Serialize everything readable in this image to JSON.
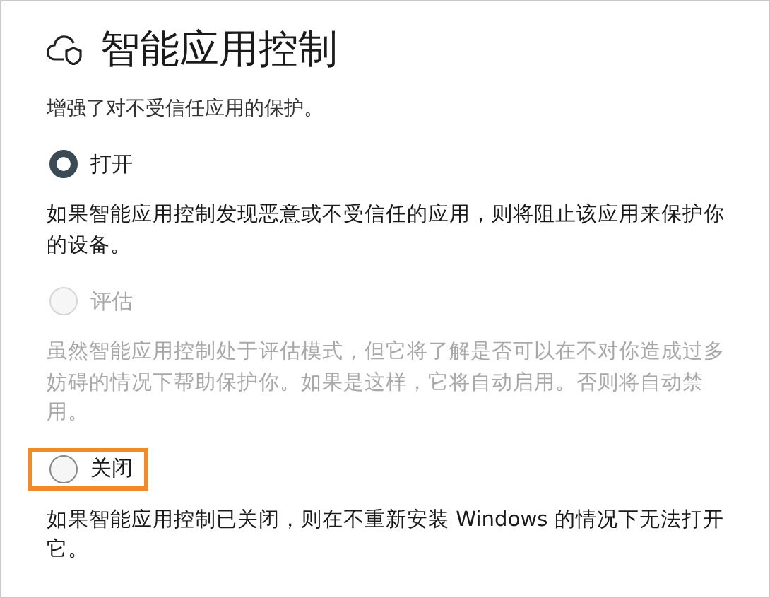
{
  "title": "智能应用控制",
  "subtitle": "增强了对不受信任应用的保护。",
  "options": [
    {
      "label": "打开",
      "selected": true,
      "disabled": false,
      "highlighted": false,
      "description": "如果智能应用控制发现恶意或不受信任的应用，则将阻止该应用来保护你的设备。"
    },
    {
      "label": "评估",
      "selected": false,
      "disabled": true,
      "highlighted": false,
      "description": "虽然智能应用控制处于评估模式，但它将了解是否可以在不对你造成过多妨碍的情况下帮助保护你。如果是这样，它将自动启用。否则将自动禁用。"
    },
    {
      "label": "关闭",
      "selected": false,
      "disabled": false,
      "highlighted": true,
      "description": "如果智能应用控制已关闭，则在不重新安装 Windows 的情况下无法打开它。"
    }
  ]
}
